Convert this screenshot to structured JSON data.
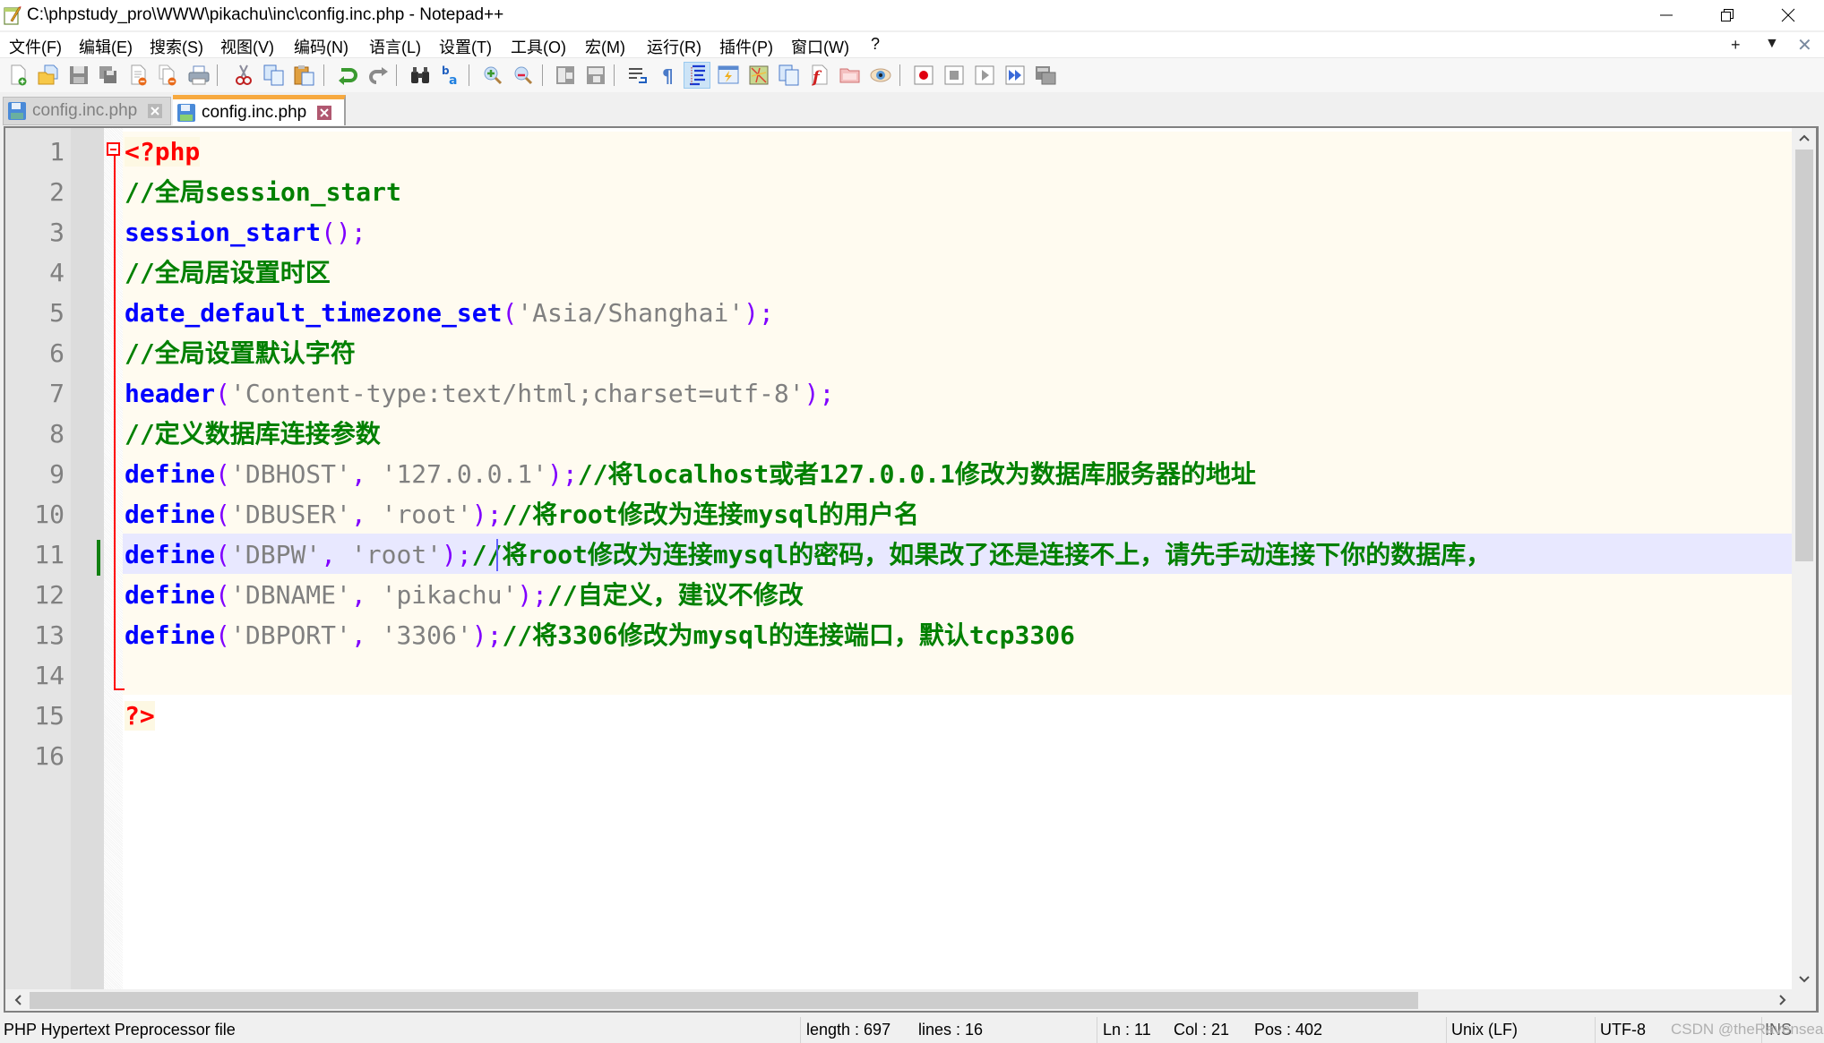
{
  "window": {
    "title": "C:\\phpstudy_pro\\WWW\\pikachu\\inc\\config.inc.php - Notepad++",
    "minimize_label": "—",
    "restore_label": "❐",
    "close_label": "✕"
  },
  "menu": {
    "items": [
      "文件(F)",
      "编辑(E)",
      "搜索(S)",
      "视图(V)",
      "编码(N)",
      "语言(L)",
      "设置(T)",
      "工具(O)",
      "宏(M)",
      "运行(R)",
      "插件(P)",
      "窗口(W)",
      "?"
    ],
    "right": {
      "add": "+",
      "dropdown": "▼",
      "close": "✕"
    }
  },
  "toolbar": {
    "icons": [
      "new-file",
      "open-file",
      "save",
      "save-all",
      "close",
      "close-all",
      "print",
      "cut",
      "copy",
      "paste",
      "undo",
      "redo",
      "find",
      "replace",
      "zoom-in",
      "zoom-out",
      "sync-vertical",
      "sync-horizontal",
      "word-wrap",
      "show-all-chars",
      "indent-guide",
      "define-language",
      "document-map",
      "function-list",
      "folder-as-workspace",
      "monitoring",
      "start-recording",
      "stop-recording",
      "playback",
      "run-macro-multiple",
      "save-macro"
    ],
    "active_icon": "indent-guide"
  },
  "tabs": [
    {
      "label": "config.inc.php",
      "active": false
    },
    {
      "label": "config.inc.php",
      "active": true
    }
  ],
  "editor": {
    "line_numbers": [
      "1",
      "2",
      "3",
      "4",
      "5",
      "6",
      "7",
      "8",
      "9",
      "10",
      "11",
      "12",
      "13",
      "14",
      "15",
      "16"
    ],
    "current_line": 11,
    "lines": [
      [
        {
          "t": "tg",
          "v": "<?php"
        }
      ],
      [
        {
          "t": "cm",
          "v": "//全局session_start"
        }
      ],
      [
        {
          "t": "kw",
          "v": "session_start"
        },
        {
          "t": "pn",
          "v": "();"
        }
      ],
      [
        {
          "t": "cm",
          "v": "//全局居设置时区"
        }
      ],
      [
        {
          "t": "kw",
          "v": "date_default_timezone_set"
        },
        {
          "t": "pn",
          "v": "("
        },
        {
          "t": "st",
          "v": "'Asia/Shanghai'"
        },
        {
          "t": "pn",
          "v": ");"
        }
      ],
      [
        {
          "t": "cm",
          "v": "//全局设置默认字符"
        }
      ],
      [
        {
          "t": "kw",
          "v": "header"
        },
        {
          "t": "pn",
          "v": "("
        },
        {
          "t": "st",
          "v": "'Content-type:text/html;charset=utf-8'"
        },
        {
          "t": "pn",
          "v": ");"
        }
      ],
      [
        {
          "t": "cm",
          "v": "//定义数据库连接参数"
        }
      ],
      [
        {
          "t": "kw",
          "v": "define"
        },
        {
          "t": "pn",
          "v": "("
        },
        {
          "t": "st",
          "v": "'DBHOST'"
        },
        {
          "t": "pn",
          "v": ", "
        },
        {
          "t": "st",
          "v": "'127.0.0.1'"
        },
        {
          "t": "pn",
          "v": ");"
        },
        {
          "t": "cm",
          "v": "//将localhost或者127.0.0.1修改为数据库服务器的地址"
        }
      ],
      [
        {
          "t": "kw",
          "v": "define"
        },
        {
          "t": "pn",
          "v": "("
        },
        {
          "t": "st",
          "v": "'DBUSER'"
        },
        {
          "t": "pn",
          "v": ", "
        },
        {
          "t": "st",
          "v": "'root'"
        },
        {
          "t": "pn",
          "v": ");"
        },
        {
          "t": "cm",
          "v": "//将root修改为连接mysql的用户名"
        }
      ],
      [
        {
          "t": "kw",
          "v": "define"
        },
        {
          "t": "pn",
          "v": "("
        },
        {
          "t": "st",
          "v": "'DBPW'"
        },
        {
          "t": "pn",
          "v": ", "
        },
        {
          "t": "st",
          "v": "'root'"
        },
        {
          "t": "pn",
          "v": ");"
        },
        {
          "t": "cm",
          "v": "//将root修改为连接mysql的密码，如果改了还是连接不上，请先手动连接下你的数据库，"
        }
      ],
      [
        {
          "t": "kw",
          "v": "define"
        },
        {
          "t": "pn",
          "v": "("
        },
        {
          "t": "st",
          "v": "'DBNAME'"
        },
        {
          "t": "pn",
          "v": ", "
        },
        {
          "t": "st",
          "v": "'pikachu'"
        },
        {
          "t": "pn",
          "v": ");"
        },
        {
          "t": "cm",
          "v": "//自定义，建议不修改"
        }
      ],
      [
        {
          "t": "kw",
          "v": "define"
        },
        {
          "t": "pn",
          "v": "("
        },
        {
          "t": "st",
          "v": "'DBPORT'"
        },
        {
          "t": "pn",
          "v": ", "
        },
        {
          "t": "st",
          "v": "'3306'"
        },
        {
          "t": "pn",
          "v": ");"
        },
        {
          "t": "cm",
          "v": "//将3306修改为mysql的连接端口，默认tcp3306"
        }
      ],
      [],
      [
        {
          "t": "tg",
          "v": "?>"
        }
      ],
      []
    ]
  },
  "statusbar": {
    "file_type": "PHP Hypertext Preprocessor file",
    "length": "length : 697",
    "lines": "lines : 16",
    "ln": "Ln : 11",
    "col": "Col : 21",
    "pos": "Pos : 402",
    "eol": "Unix (LF)",
    "encoding": "UTF-8",
    "mode": "INS",
    "watermark": "CSDN @theRavensea"
  },
  "colors": {
    "keyword": "#0000ff",
    "string": "#808080",
    "operator": "#8000ff",
    "comment": "#008000",
    "php_tag": "#ff0000",
    "current_line": "#e8e8ff",
    "active_tab_accent": "#f7a93f"
  }
}
